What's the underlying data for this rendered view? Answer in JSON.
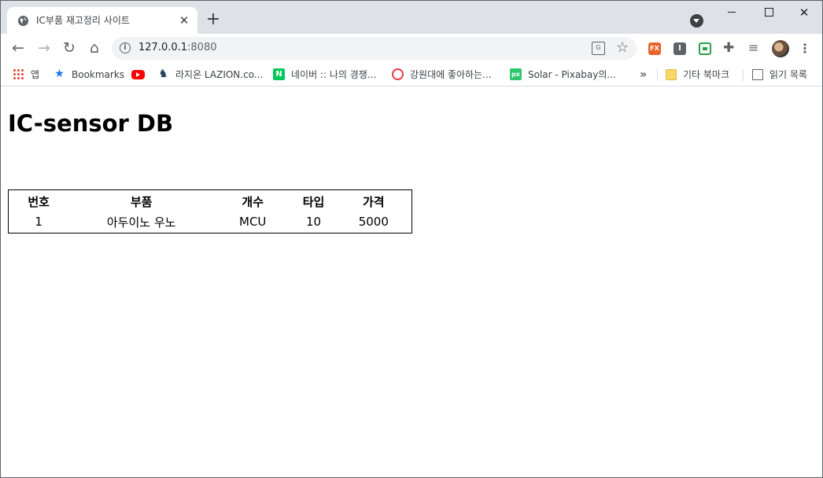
{
  "browser": {
    "tab": {
      "title": "IC부품 재고정리 사이트"
    },
    "window_controls": {
      "close_glyph": "✕"
    },
    "toolbar": {
      "url_host": "127.0.0.1",
      "url_port": ":8080"
    },
    "extensions": [
      {
        "name": "fx-extension-icon",
        "label": "FX"
      },
      {
        "name": "i-extension-icon",
        "label": "I"
      },
      {
        "name": "green-extension-icon",
        "label": ""
      }
    ],
    "bookmarks": {
      "items": [
        {
          "label": "앱"
        },
        {
          "label": "Bookmarks"
        },
        {
          "label": ""
        },
        {
          "label": "라지온 LAZION.co..."
        },
        {
          "label": "네이버 :: 나의 경쟁..."
        },
        {
          "label": "강원대에 좋아하는..."
        },
        {
          "label": "Solar - Pixabay의..."
        }
      ],
      "more": "»",
      "other_bookmarks": "기타 북마크",
      "reading_list": "읽기 목록"
    }
  },
  "page": {
    "title": "IC-sensor DB",
    "table": {
      "headers": [
        "번호",
        "부품",
        "개수",
        "타입",
        "가격"
      ],
      "rows": [
        [
          "1",
          "아두이노 우노",
          "MCU",
          "10",
          "5000"
        ]
      ]
    }
  }
}
